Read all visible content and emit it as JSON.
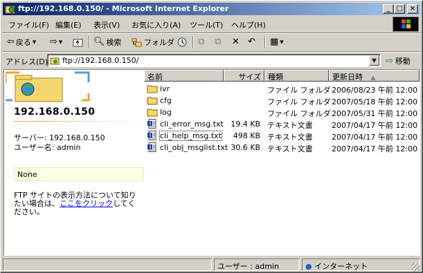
{
  "window": {
    "title": "ftp://192.168.0.150/ - Microsoft Internet Explorer",
    "min_label": "_",
    "max_label": "□",
    "close_label": "×"
  },
  "menu": {
    "items": [
      "ファイル(F)",
      "編集(E)",
      "表示(V)",
      "お気に入り(A)",
      "ツール(T)",
      "ヘルプ(H)"
    ]
  },
  "toolbar": {
    "back_label": "戻る",
    "search_label": "検索",
    "folders_label": "フォルダ",
    "history_icon": "history-icon",
    "up_icon": "up-folder-icon"
  },
  "address": {
    "label": "アドレス(D)",
    "value": "ftp://192.168.0.150/",
    "go_label": "移動"
  },
  "left_pane": {
    "host": "192.168.0.150",
    "server_line": "サーバー: 192.168.0.150",
    "user_line": "ユーザー名: admin",
    "info_box": "None",
    "help_text_before": "FTP サイトの表示方法について知りたい場合は、",
    "help_link": "ここをクリック",
    "help_text_after": "してください。"
  },
  "list": {
    "columns": [
      "名前",
      "サイズ",
      "種類",
      "更新日時"
    ],
    "sort_indicator": "▲",
    "rows": [
      {
        "name": "ivr",
        "size": "",
        "type": "ファイル フォルダ",
        "modified": "2006/08/23 午前 12:00",
        "icon": "folder-icon"
      },
      {
        "name": "cfg",
        "size": "",
        "type": "ファイル フォルダ",
        "modified": "2007/05/18 午前 12:00",
        "icon": "folder-icon"
      },
      {
        "name": "log",
        "size": "",
        "type": "ファイル フォルダ",
        "modified": "2007/05/31 午前 12:00",
        "icon": "folder-icon"
      },
      {
        "name": "cli_error_msg.txt",
        "size": "19.4 KB",
        "type": "テキスト文書",
        "modified": "2007/04/17 午前 12:00",
        "icon": "text-file-icon"
      },
      {
        "name": "cli_help_msg.txt",
        "size": "498 KB",
        "type": "テキスト文書",
        "modified": "2007/04/17 午前 12:00",
        "icon": "text-file-icon"
      },
      {
        "name": "cli_obj_msglist.txt",
        "size": "30.6 KB",
        "type": "テキスト文書",
        "modified": "2007/04/17 午前 12:00",
        "icon": "text-file-icon"
      }
    ]
  },
  "status": {
    "user": "ユーザー : admin",
    "zone": "インターネット"
  },
  "colors": {
    "titlebar_start": "#0a246a",
    "titlebar_end": "#a6caf0",
    "chrome": "#d4d0c8",
    "link": "#0000ff",
    "folder": "#f5d76e"
  }
}
